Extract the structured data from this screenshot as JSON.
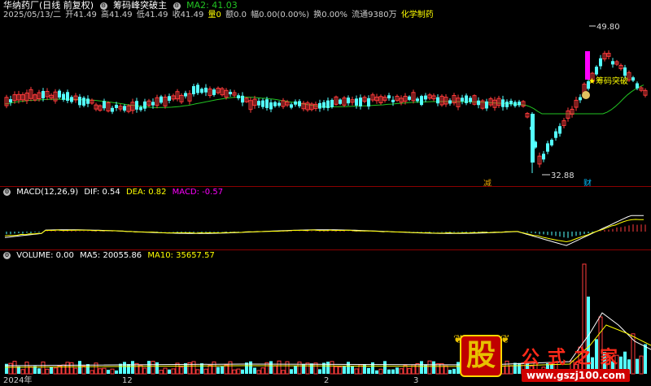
{
  "header": {
    "stock_name": "华纳药厂(日线 前复权)",
    "indicator_name": "筹码峰突破主",
    "ma2_label": "MA2: 41.03",
    "date": "2025/05/13/二",
    "open": "开41.49",
    "high": "高41.49",
    "low": "低41.49",
    "close": "收41.49",
    "volume": "量0",
    "amount": "额0.0",
    "change": "幅0.00(0.00%)",
    "turnover": "换0.00%",
    "float": "流通9380万",
    "sector": "化学制药"
  },
  "annotations": {
    "high_price": "49.80",
    "low_price": "32.88",
    "signal_text": "★筹码突破",
    "flag_jian": "减",
    "flag_cai": "财"
  },
  "macd": {
    "label": "MACD(12,26,9)",
    "dif": "DIF: 0.54",
    "dea": "DEA: 0.82",
    "macd": "MACD: -0.57"
  },
  "volume": {
    "label": "VOLUME: 0.00",
    "ma5": "MA5: 20055.86",
    "ma10": "MA10: 35657.57"
  },
  "x_axis": {
    "labels": [
      "2024年",
      "12",
      "2",
      "3"
    ]
  },
  "watermark": {
    "logo_char": "股",
    "title": "公式之家",
    "url": "www.gszj100.com"
  },
  "colors": {
    "up": "#ff3b3b",
    "down": "#54ffff",
    "ma_line": "#22c422",
    "separator": "#8b0000",
    "signal": "#ff00ff",
    "label_yellow": "#ffff00"
  }
}
